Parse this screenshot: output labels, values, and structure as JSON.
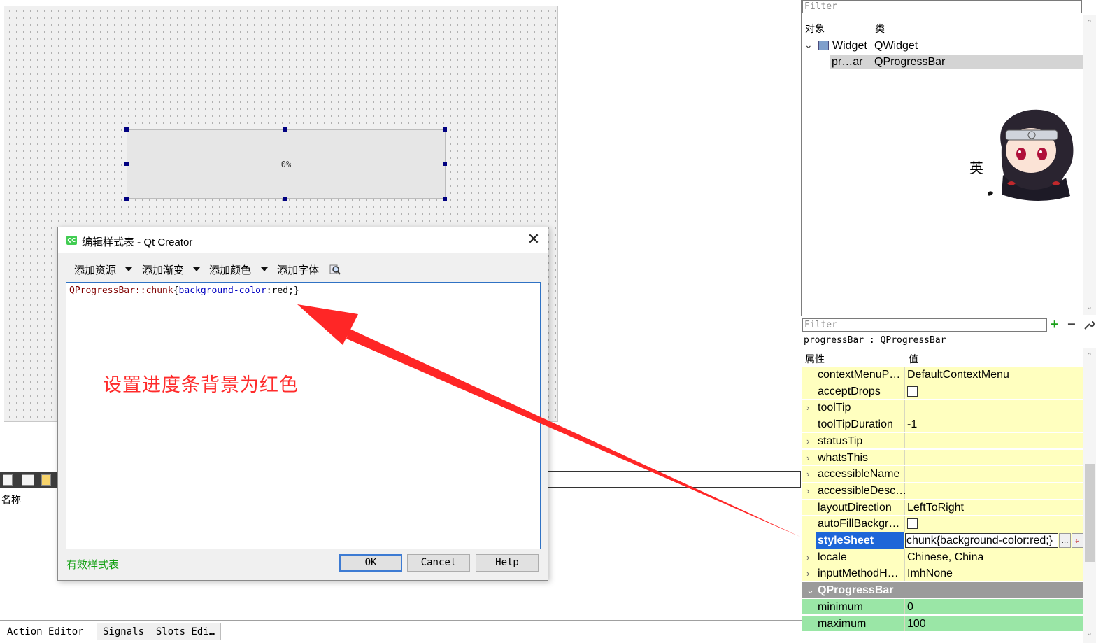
{
  "canvas": {
    "progress_text": "0%"
  },
  "left_panel": {
    "name_header": "名称"
  },
  "bottom_tabs": [
    {
      "label": "Action Editor"
    },
    {
      "label": "Signals _Slots Edi…"
    }
  ],
  "dialog": {
    "title": "编辑样式表 - Qt Creator",
    "logo_text": "QC",
    "close_glyph": "✕",
    "menus": [
      {
        "label": "添加资源"
      },
      {
        "label": "添加渐变"
      },
      {
        "label": "添加颜色"
      },
      {
        "label": "添加字体"
      }
    ],
    "code": {
      "selector": "QProgressBar::chunk",
      "open_brace": "{",
      "property": "background-color",
      "colon": ":",
      "value": "red;",
      "close_brace": "}"
    },
    "annotation": "设置进度条背景为红色",
    "status": "有效样式表",
    "buttons": {
      "ok": "OK",
      "cancel": "Cancel",
      "help": "Help"
    },
    "colors": {
      "valid": "#12a012",
      "annotation": "#ff2b2b"
    }
  },
  "object_inspector": {
    "filter_placeholder": "Filter",
    "col_object": "对象",
    "col_class": "类",
    "rows": [
      {
        "object": "Widget",
        "class": "QWidget"
      },
      {
        "object": "pr…ar",
        "class": "QProgressBar"
      }
    ],
    "ime_label": "英"
  },
  "property_editor": {
    "filter_placeholder": "Filter",
    "object_caption": "progressBar : QProgressBar",
    "col_property": "属性",
    "col_value": "值",
    "rows": [
      {
        "name": "contextMenuP…",
        "value": "DefaultContextMenu"
      },
      {
        "name": "acceptDrops",
        "value": ""
      },
      {
        "name": "toolTip",
        "value": ""
      },
      {
        "name": "toolTipDuration",
        "value": "-1"
      },
      {
        "name": "statusTip",
        "value": ""
      },
      {
        "name": "whatsThis",
        "value": ""
      },
      {
        "name": "accessibleName",
        "value": ""
      },
      {
        "name": "accessibleDesc…",
        "value": ""
      },
      {
        "name": "layoutDirection",
        "value": "LeftToRight"
      },
      {
        "name": "autoFillBackgr…",
        "value": ""
      },
      {
        "name": "styleSheet",
        "value": "chunk{background-color:red;}"
      },
      {
        "name": "locale",
        "value": "Chinese, China"
      },
      {
        "name": "inputMethodH…",
        "value": "ImhNone"
      }
    ],
    "section": "QProgressBar",
    "section_rows": [
      {
        "name": "minimum",
        "value": "0"
      },
      {
        "name": "maximum",
        "value": "100"
      }
    ],
    "stylesheet_more": "...",
    "colors": {
      "row": "#ffffbf",
      "section": "#9b9b9b",
      "section_row": "#9ae6a6",
      "selected": "#1e66d8"
    }
  }
}
